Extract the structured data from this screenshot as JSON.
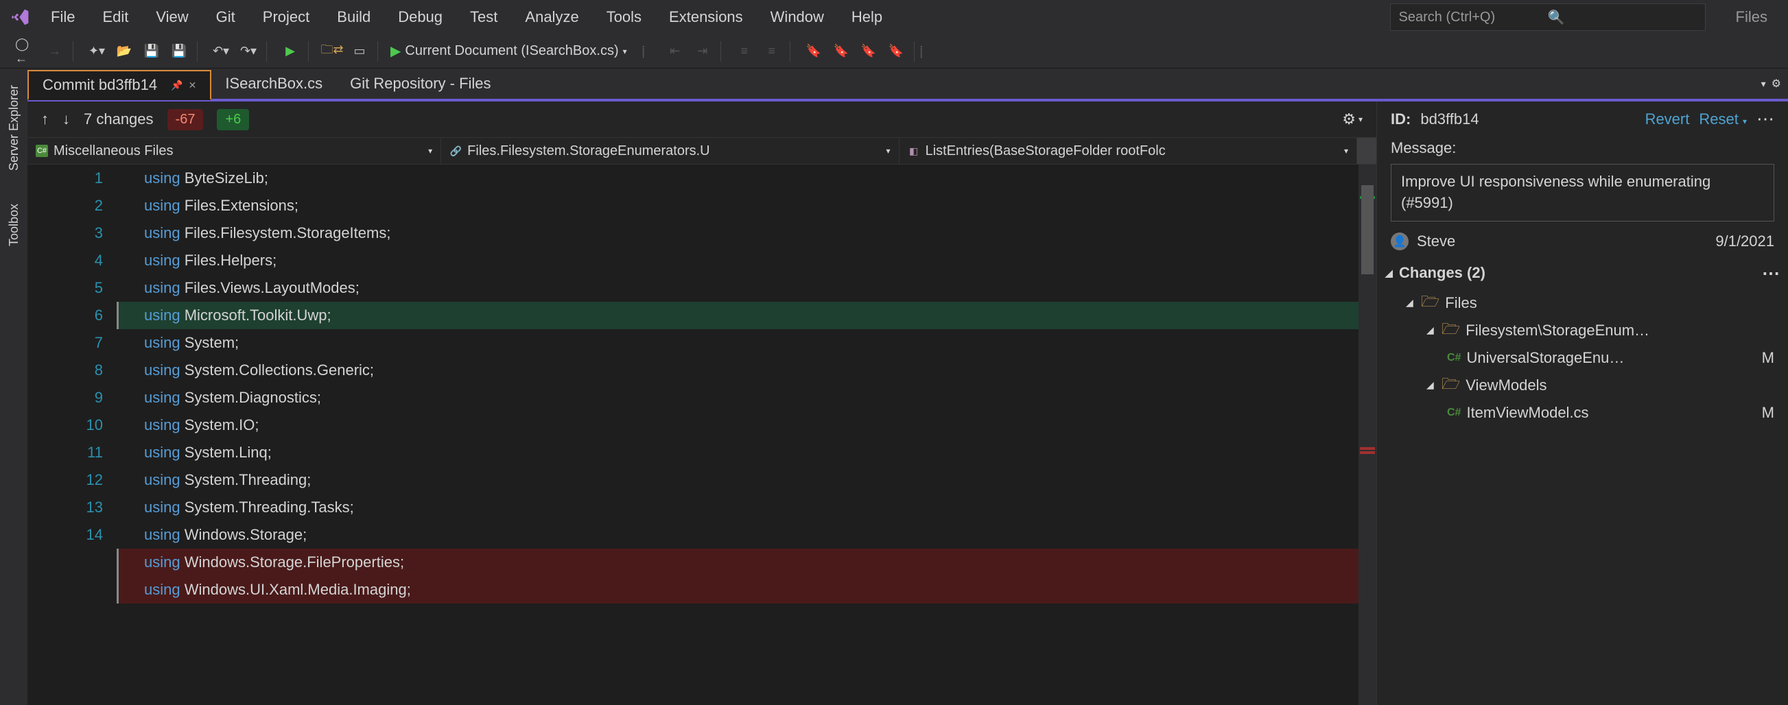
{
  "titlebar": {
    "menus": [
      "File",
      "Edit",
      "View",
      "Git",
      "Project",
      "Build",
      "Debug",
      "Test",
      "Analyze",
      "Tools",
      "Extensions",
      "Window",
      "Help"
    ],
    "search_placeholder": "Search (Ctrl+Q)",
    "right_label": "Files"
  },
  "toolbar": {
    "current_doc_label": "Current Document (ISearchBox.cs)"
  },
  "sidebar": {
    "tabs": [
      "Server Explorer",
      "Toolbox"
    ]
  },
  "doc_tabs": {
    "tabs": [
      {
        "title": "Commit bd3ffb14",
        "active": true,
        "pinned": true
      },
      {
        "title": "ISearchBox.cs",
        "active": false
      },
      {
        "title": "Git Repository - Files",
        "active": false
      }
    ]
  },
  "changes_bar": {
    "count_text": "7 changes",
    "deletions": "-67",
    "additions": "+6"
  },
  "breadcrumb": {
    "project": "Miscellaneous Files",
    "namespace": "Files.Filesystem.StorageEnumerators.U",
    "method": "ListEntries(BaseStorageFolder rootFolc"
  },
  "code": {
    "lines": [
      {
        "n": 1,
        "kw": "using",
        "rest": " ByteSizeLib;",
        "state": "normal"
      },
      {
        "n": 2,
        "kw": "using",
        "rest": " Files.Extensions;",
        "state": "normal"
      },
      {
        "n": 3,
        "kw": "using",
        "rest": " Files.Filesystem.StorageItems;",
        "state": "normal"
      },
      {
        "n": 4,
        "kw": "using",
        "rest": " Files.Helpers;",
        "state": "normal"
      },
      {
        "n": 5,
        "kw": "using",
        "rest": " Files.Views.LayoutModes;",
        "state": "normal"
      },
      {
        "n": 6,
        "kw": "using",
        "rest": " Microsoft.Toolkit.Uwp;",
        "state": "added",
        "marker": true
      },
      {
        "n": 7,
        "kw": "using",
        "rest": " System;",
        "state": "normal"
      },
      {
        "n": 8,
        "kw": "using",
        "rest": " System.Collections.Generic;",
        "state": "normal"
      },
      {
        "n": 9,
        "kw": "using",
        "rest": " System.Diagnostics;",
        "state": "normal"
      },
      {
        "n": 10,
        "kw": "using",
        "rest": " System.IO;",
        "state": "normal"
      },
      {
        "n": 11,
        "kw": "using",
        "rest": " System.Linq;",
        "state": "normal"
      },
      {
        "n": 12,
        "kw": "using",
        "rest": " System.Threading;",
        "state": "normal"
      },
      {
        "n": 13,
        "kw": "using",
        "rest": " System.Threading.Tasks;",
        "state": "normal"
      },
      {
        "n": 14,
        "kw": "using",
        "rest": " Windows.Storage;",
        "state": "normal"
      },
      {
        "n": "",
        "kw": "using",
        "rest": " Windows.Storage.FileProperties;",
        "state": "deleted",
        "marker": true
      },
      {
        "n": "",
        "kw": "using",
        "rest": " Windows.UI.Xaml.Media.Imaging;",
        "state": "deleted",
        "marker": true
      }
    ]
  },
  "commit_panel": {
    "id_label": "ID:",
    "id_value": "bd3ffb14",
    "revert": "Revert",
    "reset": "Reset",
    "message_label": "Message:",
    "message": "Improve UI responsiveness while enumerating (#5991)",
    "author": "Steve",
    "date": "9/1/2021",
    "changes_header": "Changes (2)",
    "tree": {
      "root": "Files",
      "folder1": "Filesystem\\StorageEnum…",
      "file1": "UniversalStorageEnu…",
      "folder2": "ViewModels",
      "file2": "ItemViewModel.cs",
      "status": "M"
    }
  }
}
